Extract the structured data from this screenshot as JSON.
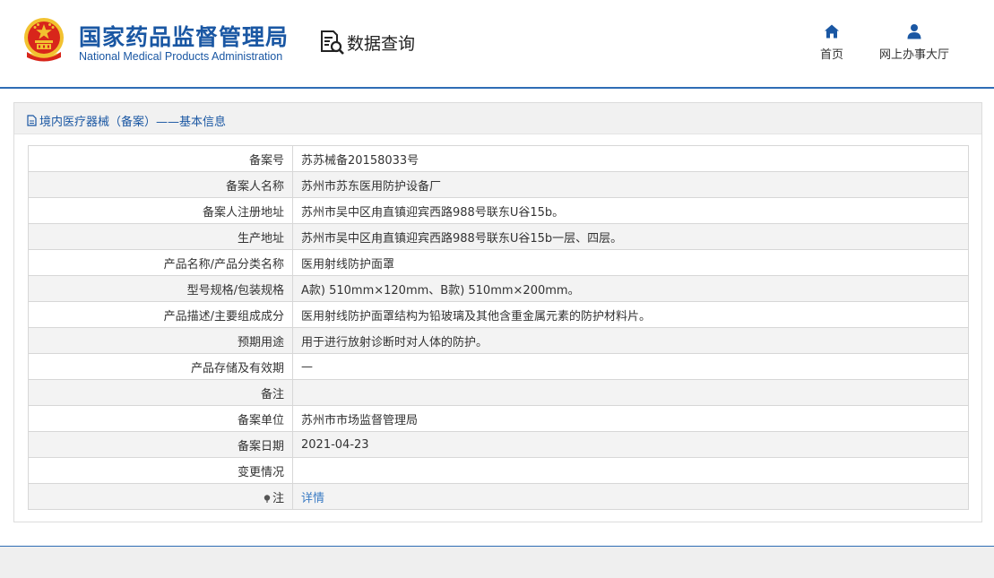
{
  "header": {
    "agency_cn": "国家药品监督管理局",
    "agency_en": "National Medical Products Administration",
    "section_title": "数据查询",
    "emblem_icon": "national-emblem-icon",
    "query_icon": "data-query-icon",
    "nav": {
      "home_label": "首页",
      "home_icon": "home-icon",
      "hall_label": "网上办事大厅",
      "hall_icon": "user-icon"
    }
  },
  "panel": {
    "title": "境内医疗器械（备案）——基本信息",
    "title_icon": "document-icon"
  },
  "record": [
    {
      "label": "备案号",
      "value": "苏苏械备20158033号"
    },
    {
      "label": "备案人名称",
      "value": "苏州市苏东医用防护设备厂"
    },
    {
      "label": "备案人注册地址",
      "value": "苏州市吴中区甪直镇迎宾西路988号联东U谷15b。"
    },
    {
      "label": "生产地址",
      "value": "苏州市吴中区甪直镇迎宾西路988号联东U谷15b一层、四层。"
    },
    {
      "label": "产品名称/产品分类名称",
      "value": "医用射线防护面罩"
    },
    {
      "label": "型号规格/包装规格",
      "value": "A款) 510mm×120mm、B款) 510mm×200mm。"
    },
    {
      "label": "产品描述/主要组成成分",
      "value": "医用射线防护面罩结构为铅玻璃及其他含重金属元素的防护材料片。"
    },
    {
      "label": "预期用途",
      "value": "用于进行放射诊断时对人体的防护。"
    },
    {
      "label": "产品存储及有效期",
      "value": "—"
    },
    {
      "label": "备注",
      "value": ""
    },
    {
      "label": "备案单位",
      "value": "苏州市市场监督管理局"
    },
    {
      "label": "备案日期",
      "value": "2021-04-23"
    },
    {
      "label": "变更情况",
      "value": ""
    }
  ],
  "note_row": {
    "label": "注",
    "label_icon": "pin-icon",
    "link": "详情"
  },
  "colors": {
    "brand_blue": "#1a57a3",
    "header_rule": "#2f6db5",
    "link": "#3a7bc4",
    "row_alt": "#f3f3f3",
    "emblem_red": "#d8261b",
    "emblem_gold": "#f2c230"
  }
}
